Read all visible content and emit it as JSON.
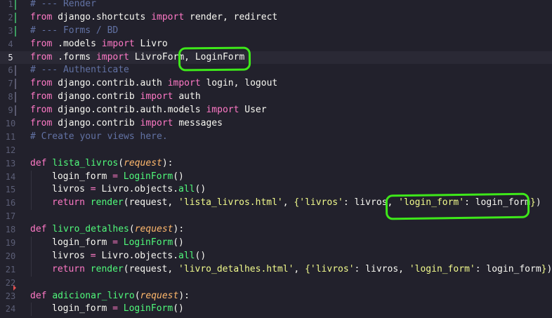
{
  "editor": {
    "active_line": 5,
    "lines": [
      {
        "n": "1",
        "git": "add",
        "tokens": [
          [
            "cmt",
            "# --- Render"
          ]
        ]
      },
      {
        "n": "2",
        "git": "add",
        "tokens": [
          [
            "kw",
            "from"
          ],
          [
            "txt",
            " django.shortcuts "
          ],
          [
            "kw",
            "import"
          ],
          [
            "txt",
            " render, redirect"
          ]
        ]
      },
      {
        "n": "3",
        "git": "add",
        "tokens": [
          [
            "cmt",
            "# --- Forms / BD"
          ]
        ]
      },
      {
        "n": "4",
        "git": "",
        "tokens": [
          [
            "kw",
            "from"
          ],
          [
            "txt",
            " .models "
          ],
          [
            "kw",
            "import"
          ],
          [
            "txt",
            " Livro"
          ]
        ]
      },
      {
        "n": "5",
        "git": "",
        "tokens": [
          [
            "kw",
            "from"
          ],
          [
            "txt",
            " .forms "
          ],
          [
            "kw",
            "import"
          ],
          [
            "txt",
            " LivroForm, LoginForm"
          ]
        ]
      },
      {
        "n": "6",
        "git": "mod",
        "tokens": [
          [
            "cmt",
            "# --- Authenticate"
          ]
        ]
      },
      {
        "n": "7",
        "git": "mod",
        "tokens": [
          [
            "kw",
            "from"
          ],
          [
            "txt",
            " django.contrib.auth "
          ],
          [
            "kw",
            "import"
          ],
          [
            "txt",
            " login, logout"
          ]
        ]
      },
      {
        "n": "8",
        "git": "mod",
        "tokens": [
          [
            "kw",
            "from"
          ],
          [
            "txt",
            " django.contrib "
          ],
          [
            "kw",
            "import"
          ],
          [
            "txt",
            " auth"
          ]
        ]
      },
      {
        "n": "9",
        "git": "mod",
        "tokens": [
          [
            "kw",
            "from"
          ],
          [
            "txt",
            " django.contrib.auth.models "
          ],
          [
            "kw",
            "import"
          ],
          [
            "txt",
            " User"
          ]
        ]
      },
      {
        "n": "10",
        "git": "",
        "tokens": [
          [
            "kw",
            "from"
          ],
          [
            "txt",
            " django.contrib "
          ],
          [
            "kw",
            "import"
          ],
          [
            "txt",
            " messages"
          ]
        ]
      },
      {
        "n": "11",
        "git": "",
        "tokens": [
          [
            "cmt",
            "# Create your views here."
          ]
        ]
      },
      {
        "n": "12",
        "git": "",
        "tokens": []
      },
      {
        "n": "13",
        "git": "",
        "tokens": [
          [
            "kw",
            "def"
          ],
          [
            "txt",
            " "
          ],
          [
            "fn",
            "lista_livros"
          ],
          [
            "txt",
            "("
          ],
          [
            "param",
            "request"
          ],
          [
            "txt",
            "):"
          ]
        ]
      },
      {
        "n": "14",
        "git": "",
        "indent": 1,
        "tokens": [
          [
            "txt",
            "login_form "
          ],
          [
            "kw",
            "="
          ],
          [
            "txt",
            " "
          ],
          [
            "fn",
            "LoginForm"
          ],
          [
            "txt",
            "()"
          ]
        ]
      },
      {
        "n": "15",
        "git": "",
        "indent": 1,
        "tokens": [
          [
            "txt",
            "livros "
          ],
          [
            "kw",
            "="
          ],
          [
            "txt",
            " Livro.objects."
          ],
          [
            "fn",
            "all"
          ],
          [
            "txt",
            "()"
          ]
        ]
      },
      {
        "n": "16",
        "git": "",
        "indent": 1,
        "tokens": [
          [
            "kw",
            "return"
          ],
          [
            "txt",
            " "
          ],
          [
            "fn",
            "render"
          ],
          [
            "txt",
            "(request, "
          ],
          [
            "str",
            "'lista_livros.html'"
          ],
          [
            "txt",
            ", "
          ],
          [
            "brace",
            "{"
          ],
          [
            "str",
            "'livros'"
          ],
          [
            "txt",
            ": livros, "
          ],
          [
            "str",
            "'login_form'"
          ],
          [
            "txt",
            ": login_form"
          ],
          [
            "brace",
            "}"
          ],
          [
            "txt",
            ")"
          ]
        ]
      },
      {
        "n": "17",
        "git": "",
        "tokens": []
      },
      {
        "n": "18",
        "git": "",
        "tokens": [
          [
            "kw",
            "def"
          ],
          [
            "txt",
            " "
          ],
          [
            "fn",
            "livro_detalhes"
          ],
          [
            "txt",
            "("
          ],
          [
            "param",
            "request"
          ],
          [
            "txt",
            "):"
          ]
        ]
      },
      {
        "n": "19",
        "git": "",
        "indent": 1,
        "tokens": [
          [
            "txt",
            "login_form "
          ],
          [
            "kw",
            "="
          ],
          [
            "txt",
            " "
          ],
          [
            "fn",
            "LoginForm"
          ],
          [
            "txt",
            "()"
          ]
        ]
      },
      {
        "n": "20",
        "git": "",
        "indent": 1,
        "tokens": [
          [
            "txt",
            "livros "
          ],
          [
            "kw",
            "="
          ],
          [
            "txt",
            " Livro.objects."
          ],
          [
            "fn",
            "all"
          ],
          [
            "txt",
            "()"
          ]
        ]
      },
      {
        "n": "21",
        "git": "",
        "indent": 1,
        "tokens": [
          [
            "kw",
            "return"
          ],
          [
            "txt",
            " "
          ],
          [
            "fn",
            "render"
          ],
          [
            "txt",
            "(request, "
          ],
          [
            "str",
            "'livro_detalhes.html'"
          ],
          [
            "txt",
            ", "
          ],
          [
            "brace",
            "{"
          ],
          [
            "str",
            "'livros'"
          ],
          [
            "txt",
            ": livros, "
          ],
          [
            "str",
            "'login_form'"
          ],
          [
            "txt",
            ": login_form"
          ],
          [
            "brace",
            "}"
          ],
          [
            "txt",
            ")"
          ]
        ]
      },
      {
        "n": "22",
        "git": "del",
        "tokens": []
      },
      {
        "n": "23",
        "git": "",
        "tokens": [
          [
            "kw",
            "def"
          ],
          [
            "txt",
            " "
          ],
          [
            "fn",
            "adicionar_livro"
          ],
          [
            "txt",
            "("
          ],
          [
            "param",
            "request"
          ],
          [
            "txt",
            "):"
          ]
        ]
      },
      {
        "n": "24",
        "git": "",
        "indent": 1,
        "tokens": [
          [
            "txt",
            "login_form "
          ],
          [
            "kw",
            "="
          ],
          [
            "txt",
            " "
          ],
          [
            "fn",
            "LoginForm"
          ],
          [
            "txt",
            "()"
          ]
        ]
      }
    ]
  },
  "annotations": {
    "highlight_color": "#3ee81a"
  }
}
